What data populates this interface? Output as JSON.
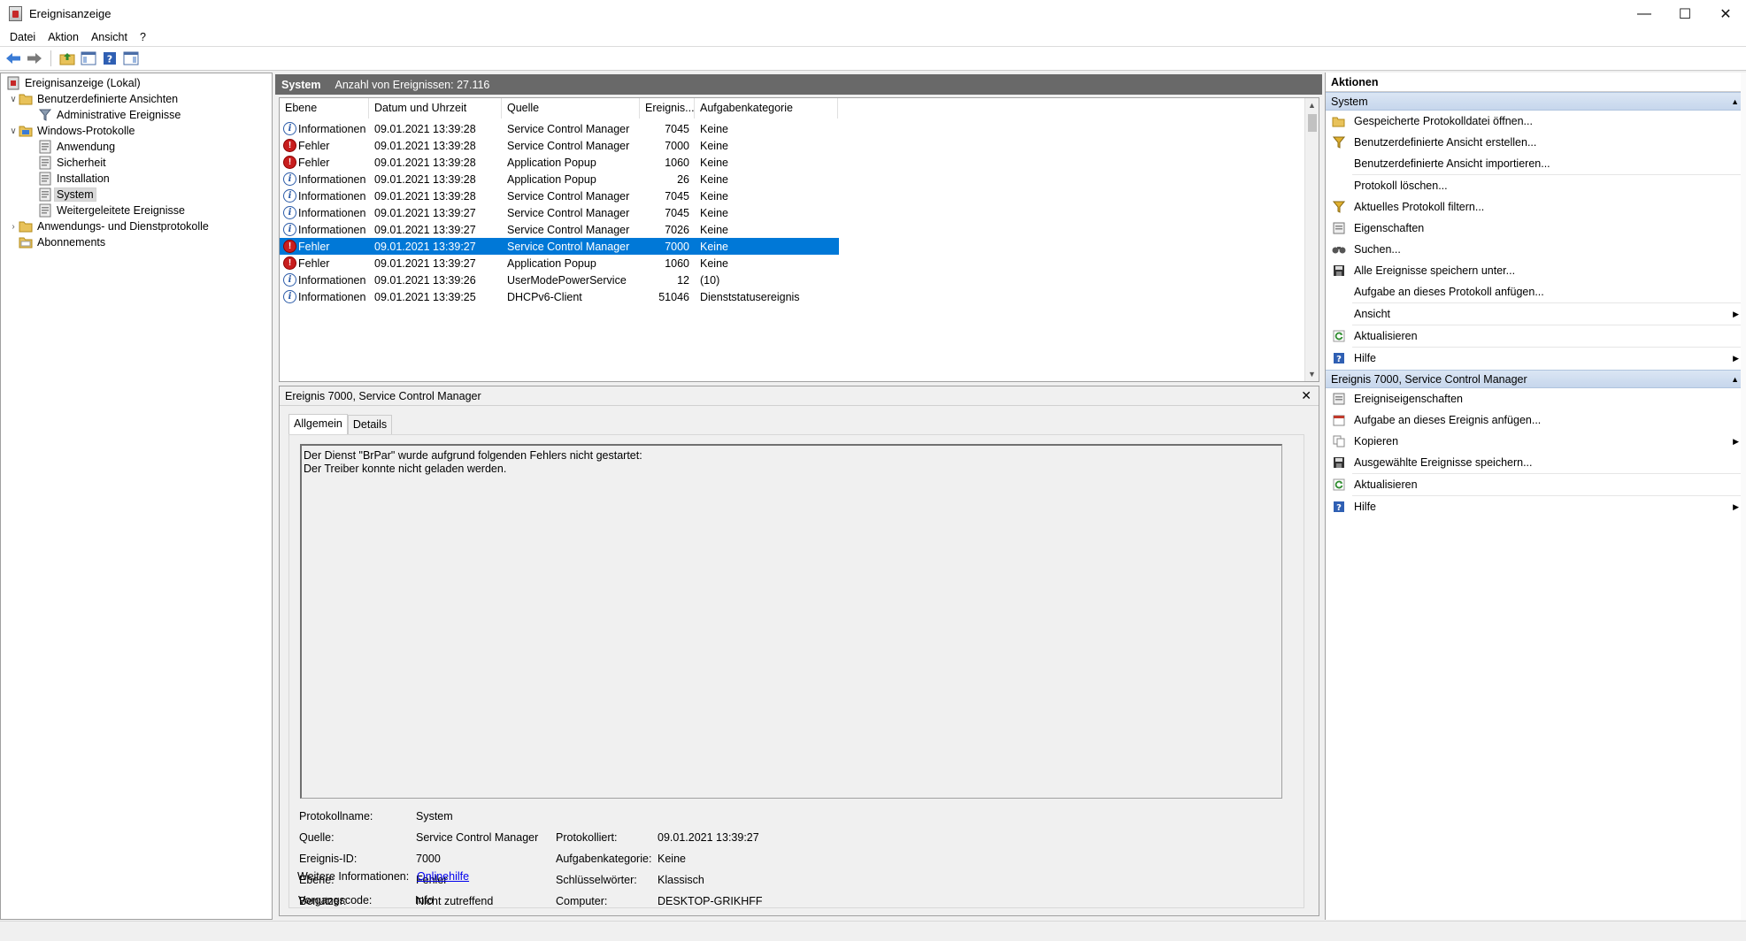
{
  "window": {
    "title": "Ereignisanzeige"
  },
  "menu": [
    "Datei",
    "Aktion",
    "Ansicht",
    "?"
  ],
  "tree": [
    {
      "label": "Ereignisanzeige (Lokal)",
      "icon": "event-viewer-icon"
    },
    {
      "label": "Benutzerdefinierte Ansichten",
      "icon": "folder-icon"
    },
    {
      "label": "Administrative Ereignisse",
      "icon": "filter-icon"
    },
    {
      "label": "Windows-Protokolle",
      "icon": "folder-icon"
    },
    {
      "label": "Anwendung",
      "icon": "log-icon"
    },
    {
      "label": "Sicherheit",
      "icon": "log-icon"
    },
    {
      "label": "Installation",
      "icon": "log-icon"
    },
    {
      "label": "System",
      "icon": "log-icon",
      "selected": true
    },
    {
      "label": "Weitergeleitete Ereignisse",
      "icon": "log-icon"
    },
    {
      "label": "Anwendungs- und Dienstprotokolle",
      "icon": "folder-icon"
    },
    {
      "label": "Abonnements",
      "icon": "subscription-icon"
    }
  ],
  "list": {
    "title": "System",
    "count_text": "Anzahl von Ereignissen: 27.116",
    "columns": [
      "Ebene",
      "Datum und Uhrzeit",
      "Quelle",
      "Ereignis...",
      "Aufgabenkategorie"
    ],
    "rows": [
      {
        "level": "Informationen",
        "date": "09.01.2021 13:39:28",
        "source": "Service Control Manager",
        "id": "7045",
        "category": "Keine"
      },
      {
        "level": "Fehler",
        "date": "09.01.2021 13:39:28",
        "source": "Service Control Manager",
        "id": "7000",
        "category": "Keine"
      },
      {
        "level": "Fehler",
        "date": "09.01.2021 13:39:28",
        "source": "Application Popup",
        "id": "1060",
        "category": "Keine"
      },
      {
        "level": "Informationen",
        "date": "09.01.2021 13:39:28",
        "source": "Application Popup",
        "id": "26",
        "category": "Keine"
      },
      {
        "level": "Informationen",
        "date": "09.01.2021 13:39:28",
        "source": "Service Control Manager",
        "id": "7045",
        "category": "Keine"
      },
      {
        "level": "Informationen",
        "date": "09.01.2021 13:39:27",
        "source": "Service Control Manager",
        "id": "7045",
        "category": "Keine"
      },
      {
        "level": "Informationen",
        "date": "09.01.2021 13:39:27",
        "source": "Service Control Manager",
        "id": "7026",
        "category": "Keine"
      },
      {
        "level": "Fehler",
        "date": "09.01.2021 13:39:27",
        "source": "Service Control Manager",
        "id": "7000",
        "category": "Keine",
        "selected": true
      },
      {
        "level": "Fehler",
        "date": "09.01.2021 13:39:27",
        "source": "Application Popup",
        "id": "1060",
        "category": "Keine"
      },
      {
        "level": "Informationen",
        "date": "09.01.2021 13:39:26",
        "source": "UserModePowerService",
        "id": "12",
        "category": "(10)"
      },
      {
        "level": "Informationen",
        "date": "09.01.2021 13:39:25",
        "source": "DHCPv6-Client",
        "id": "51046",
        "category": "Dienststatusereignis"
      }
    ]
  },
  "detail": {
    "title": "Ereignis 7000, Service Control Manager",
    "tabs": [
      "Allgemein",
      "Details"
    ],
    "message_line1": "Der Dienst \"BrPar\" wurde aufgrund folgenden Fehlers nicht gestartet:",
    "message_line2": "Der Treiber konnte nicht geladen werden.",
    "props": {
      "protokollname_label": "Protokollname:",
      "protokollname": "System",
      "quelle_label": "Quelle:",
      "quelle": "Service Control Manager",
      "protokolliert_label": "Protokolliert:",
      "protokolliert": "09.01.2021 13:39:27",
      "ereignis_id_label": "Ereignis-ID:",
      "ereignis_id": "7000",
      "aufgabenkategorie_label": "Aufgabenkategorie:",
      "aufgabenkategorie": "Keine",
      "ebene_label": "Ebene:",
      "ebene": "Fehler",
      "schluesselwoerter_label": "Schlüsselwörter:",
      "schluesselwoerter": "Klassisch",
      "benutzer_label": "Benutzer:",
      "benutzer": "Nicht zutreffend",
      "computer_label": "Computer:",
      "computer": "DESKTOP-GRIKHFF",
      "vorgangscode_label": "Vorgangscode:",
      "vorgangscode": "Info",
      "weitere_label": "Weitere Informationen:",
      "weitere_link": "Onlinehilfe"
    }
  },
  "actions": {
    "title": "Aktionen",
    "section1": "System",
    "section1_items": [
      {
        "label": "Gespeicherte Protokolldatei öffnen...",
        "icon": "open-folder-icon"
      },
      {
        "label": "Benutzerdefinierte Ansicht erstellen...",
        "icon": "filter-icon"
      },
      {
        "label": "Benutzerdefinierte Ansicht importieren...",
        "icon": ""
      },
      {
        "label": "Protokoll löschen...",
        "icon": "",
        "sep_before": true
      },
      {
        "label": "Aktuelles Protokoll filtern...",
        "icon": "filter-icon"
      },
      {
        "label": "Eigenschaften",
        "icon": "properties-icon"
      },
      {
        "label": "Suchen...",
        "icon": "binoculars-icon"
      },
      {
        "label": "Alle Ereignisse speichern unter...",
        "icon": "save-icon"
      },
      {
        "label": "Aufgabe an dieses Protokoll anfügen...",
        "icon": ""
      },
      {
        "label": "Ansicht",
        "icon": "",
        "submenu": true,
        "sep_before": true
      },
      {
        "label": "Aktualisieren",
        "icon": "refresh-icon",
        "sep_before": true
      },
      {
        "label": "Hilfe",
        "icon": "help-icon",
        "submenu": true,
        "sep_before": true
      }
    ],
    "section2": "Ereignis 7000, Service Control Manager",
    "section2_items": [
      {
        "label": "Ereigniseigenschaften",
        "icon": "properties-icon"
      },
      {
        "label": "Aufgabe an dieses Ereignis anfügen...",
        "icon": "task-icon"
      },
      {
        "label": "Kopieren",
        "icon": "copy-icon",
        "submenu": true
      },
      {
        "label": "Ausgewählte Ereignisse speichern...",
        "icon": "save-icon"
      },
      {
        "label": "Aktualisieren",
        "icon": "refresh-icon",
        "sep_before": true
      },
      {
        "label": "Hilfe",
        "icon": "help-icon",
        "submenu": true,
        "sep_before": true
      }
    ]
  }
}
